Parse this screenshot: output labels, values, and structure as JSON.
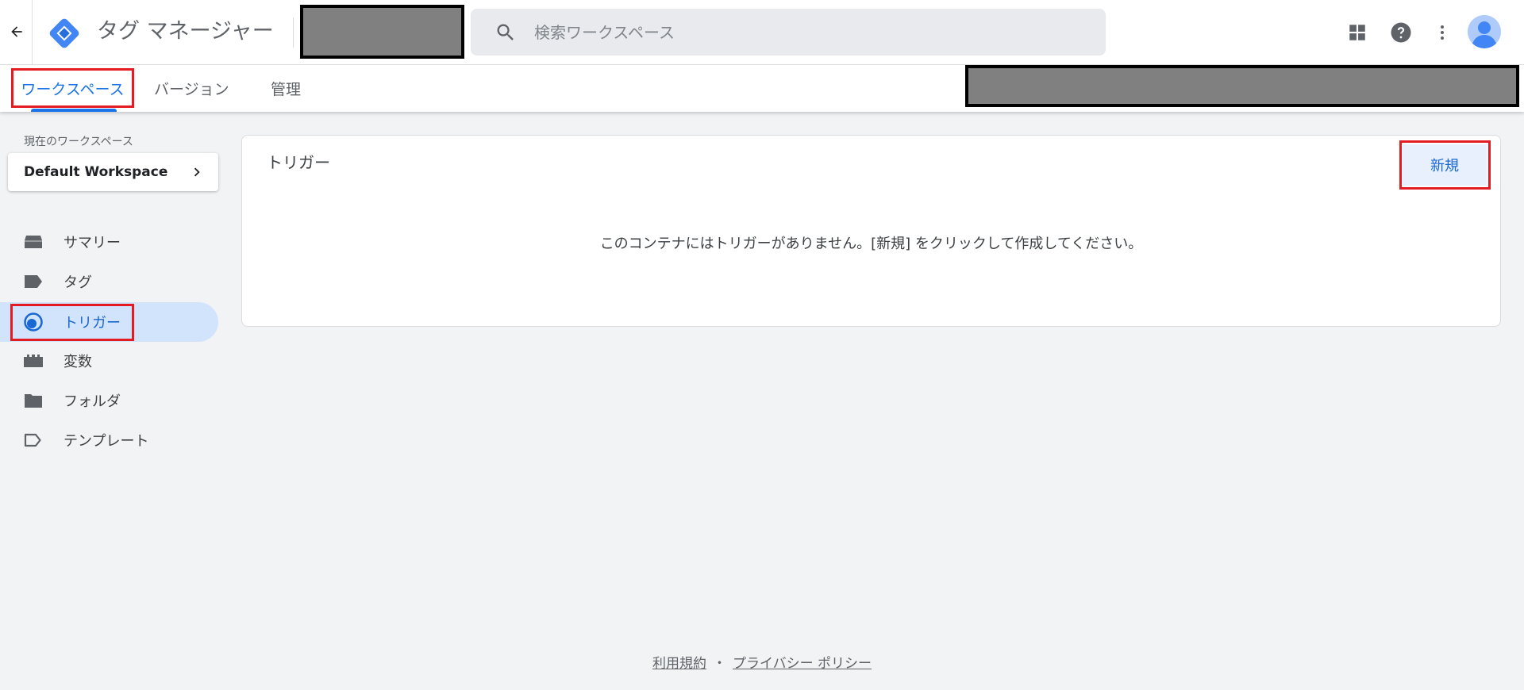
{
  "header": {
    "app_title": "タグ マネージャー",
    "search": {
      "placeholder": "検索ワークスペース",
      "value": ""
    },
    "icons": [
      "back-arrow-icon",
      "gtm-logo-icon",
      "search-icon",
      "apps-grid-icon",
      "help-icon",
      "more-vert-icon",
      "account-avatar-icon"
    ]
  },
  "tabs": [
    {
      "label": "ワークスペース",
      "active": true
    },
    {
      "label": "バージョン",
      "active": false
    },
    {
      "label": "管理",
      "active": false
    }
  ],
  "sidebar": {
    "workspace_label": "現在のワークスペース",
    "workspace_name": "Default Workspace",
    "items": [
      {
        "label": "サマリー",
        "icon": "summary-icon",
        "active": false
      },
      {
        "label": "タグ",
        "icon": "tag-icon",
        "active": false
      },
      {
        "label": "トリガー",
        "icon": "trigger-icon",
        "active": true
      },
      {
        "label": "変数",
        "icon": "variables-icon",
        "active": false
      },
      {
        "label": "フォルダ",
        "icon": "folder-icon",
        "active": false
      },
      {
        "label": "テンプレート",
        "icon": "template-icon",
        "active": false
      }
    ]
  },
  "main": {
    "card_title": "トリガー",
    "new_button_label": "新規",
    "empty_message": "このコンテナにはトリガーがありません。[新規] をクリックして作成してください。"
  },
  "footer": {
    "terms_link": "利用規約",
    "separator": "・",
    "privacy_link": "プライバシー ポリシー"
  },
  "colors": {
    "accent": "#1a73e8",
    "active_nav_bg": "#d2e3fc",
    "highlight_outline": "#e41b23",
    "redaction_fill": "#808080",
    "page_bg": "#f1f3f4"
  }
}
